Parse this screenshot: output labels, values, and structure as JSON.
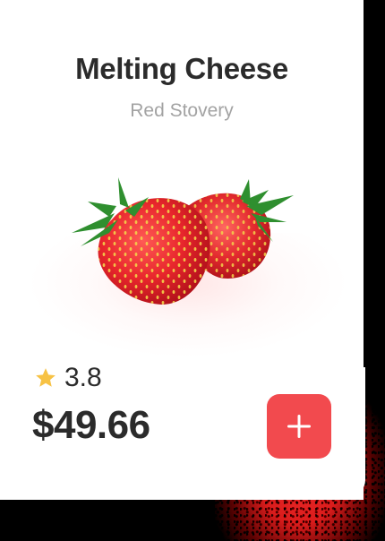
{
  "product": {
    "name": "Melting Cheese",
    "vendor": "Red Stovery",
    "rating": "3.8",
    "price": "$49.66",
    "image_icon": "strawberry-image",
    "add_icon": "plus-icon",
    "star_icon": "star-icon"
  },
  "colors": {
    "accent": "#f24a4e",
    "star": "#f7c244",
    "title_text": "#2b2b2b",
    "subtitle_text": "#a3a3a3"
  }
}
